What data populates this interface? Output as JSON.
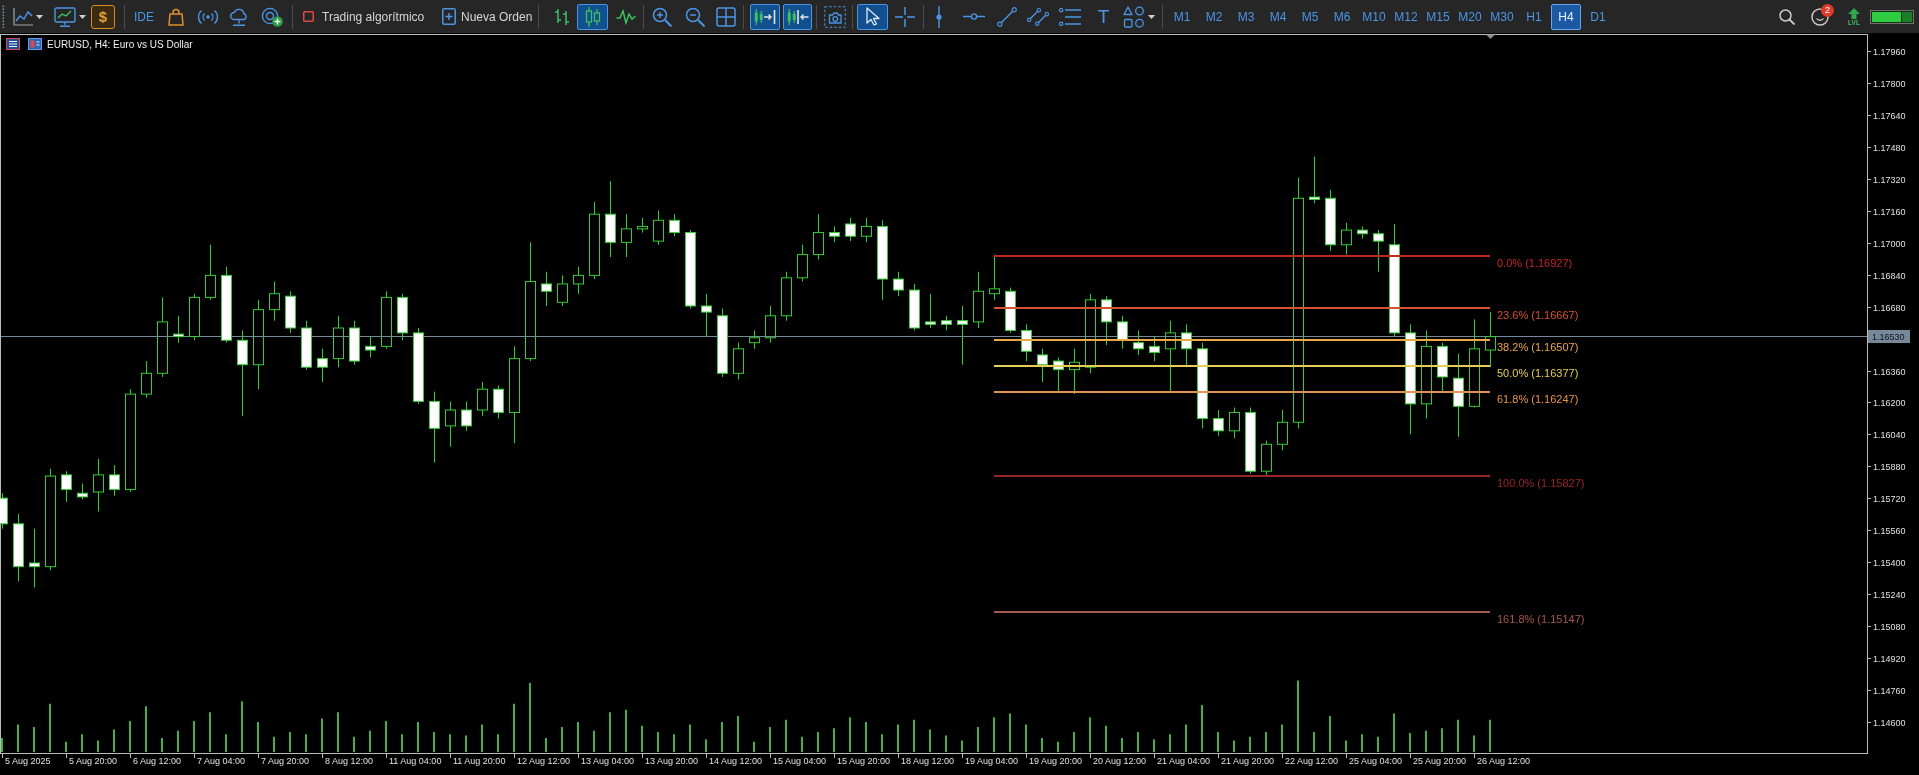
{
  "toolbar": {
    "market_symbol": "$",
    "ide_label": "IDE",
    "algo_trading": {
      "label": "Trading algorítmico",
      "on": false
    },
    "new_order": {
      "label": "Nueva Orden"
    },
    "chart_types": [
      {
        "selected": false
      },
      {
        "selected": true
      },
      {
        "selected": false
      }
    ],
    "auto_scroll": {
      "on": true
    },
    "chart_shift": {
      "on": true
    },
    "pointer_tools": [
      {
        "selected": true
      },
      {
        "selected": false
      }
    ],
    "text_tool_symbol": "T",
    "timeframes": [
      {
        "label": "M1",
        "selected": false
      },
      {
        "label": "M2",
        "selected": false
      },
      {
        "label": "M3",
        "selected": false
      },
      {
        "label": "M4",
        "selected": false
      },
      {
        "label": "M5",
        "selected": false
      },
      {
        "label": "M6",
        "selected": false
      },
      {
        "label": "M10",
        "selected": false
      },
      {
        "label": "M12",
        "selected": false
      },
      {
        "label": "M15",
        "selected": false
      },
      {
        "label": "M20",
        "selected": false
      },
      {
        "label": "M30",
        "selected": false
      },
      {
        "label": "H1",
        "selected": false
      },
      {
        "label": "H4",
        "selected": true
      },
      {
        "label": "D1",
        "selected": false
      }
    ],
    "notifications": {
      "badge": "2"
    },
    "level_label": "LVL"
  },
  "chart": {
    "title": "EURUSD, H4: Euro vs US Dollar",
    "price_ticks": [
      "1.17960",
      "1.17800",
      "1.17640",
      "1.17480",
      "1.17320",
      "1.17160",
      "1.17000",
      "1.16840",
      "1.16680",
      "1.16360",
      "1.16200",
      "1.16040",
      "1.15880",
      "1.15720",
      "1.15560",
      "1.15400",
      "1.15240",
      "1.15080",
      "1.14920",
      "1.14760",
      "1.14600"
    ],
    "current_price": "1.16530",
    "time_labels": [
      "5 Aug 2025",
      "5 Aug 20:00",
      "6 Aug 12:00",
      "7 Aug 04:00",
      "7 Aug 20:00",
      "8 Aug 12:00",
      "11 Aug 04:00",
      "11 Aug 20:00",
      "12 Aug 12:00",
      "13 Aug 04:00",
      "13 Aug 20:00",
      "14 Aug 12:00",
      "15 Aug 04:00",
      "15 Aug 20:00",
      "18 Aug 12:00",
      "19 Aug 04:00",
      "19 Aug 20:00",
      "20 Aug 12:00",
      "21 Aug 04:00",
      "21 Aug 20:00",
      "22 Aug 12:00",
      "25 Aug 04:00",
      "25 Aug 20:00",
      "26 Aug 12:00"
    ],
    "fibonacci_levels": [
      {
        "label": "0.0% (1.16927)",
        "color": "#c4261e"
      },
      {
        "label": "23.6% (1.16667)",
        "color": "#d8522e"
      },
      {
        "label": "38.2% (1.16507)",
        "color": "#e8a848"
      },
      {
        "label": "50.0% (1.16377)",
        "color": "#e6cc58"
      },
      {
        "label": "61.8% (1.16247)",
        "color": "#e4934a"
      },
      {
        "label": "100.0% (1.15827)",
        "color": "#9a2424"
      },
      {
        "label": "161.8% (1.15147)",
        "color": "#a45a48"
      }
    ]
  }
}
